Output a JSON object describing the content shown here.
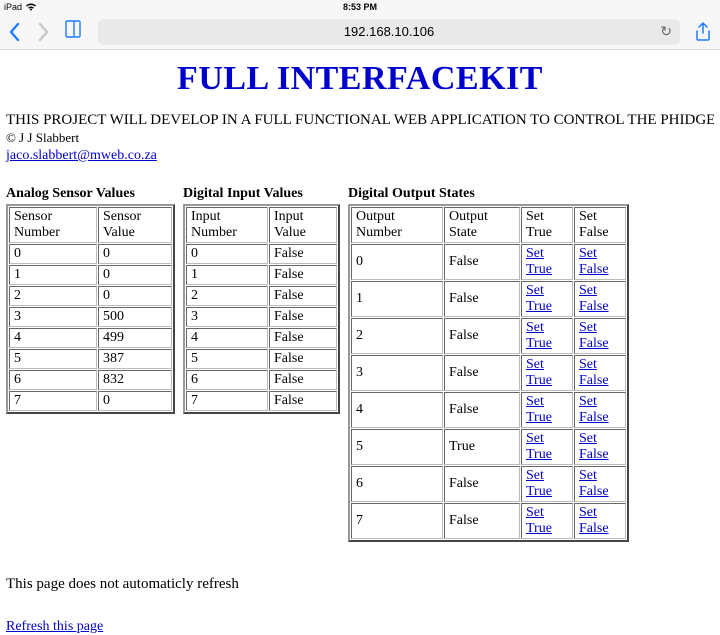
{
  "statusbar": {
    "device": "iPad",
    "time": "8:53 PM"
  },
  "toolbar": {
    "url": "192.168.10.106"
  },
  "page": {
    "title": "FULL INTERFACEKIT",
    "description": "THIS PROJECT WILL DEVELOP IN A FULL FUNCTIONAL WEB APPLICATION TO CONTROL THE PHIDGETS",
    "copyright": "© J J Slabbert",
    "email": "jaco.slabbert@mweb.co.za",
    "refresh_note": "This page does not automaticly refresh",
    "refresh_link": "Refresh this page"
  },
  "analog": {
    "heading": "Analog Sensor Values",
    "col1": "Sensor Number",
    "col2": "Sensor Value",
    "rows": [
      {
        "n": "0",
        "v": "0"
      },
      {
        "n": "1",
        "v": "0"
      },
      {
        "n": "2",
        "v": "0"
      },
      {
        "n": "3",
        "v": "500"
      },
      {
        "n": "4",
        "v": "499"
      },
      {
        "n": "5",
        "v": "387"
      },
      {
        "n": "6",
        "v": "832"
      },
      {
        "n": "7",
        "v": "0"
      }
    ]
  },
  "digital_in": {
    "heading": "Digital Input Values",
    "col1": "Input Number",
    "col2": "Input Value",
    "rows": [
      {
        "n": "0",
        "v": "False"
      },
      {
        "n": "1",
        "v": "False"
      },
      {
        "n": "2",
        "v": "False"
      },
      {
        "n": "3",
        "v": "False"
      },
      {
        "n": "4",
        "v": "False"
      },
      {
        "n": "5",
        "v": "False"
      },
      {
        "n": "6",
        "v": "False"
      },
      {
        "n": "7",
        "v": "False"
      }
    ]
  },
  "digital_out": {
    "heading": "Digital Output States",
    "col1": "Output Number",
    "col2": "Output State",
    "col3": "Set True",
    "col4": "Set False",
    "set_true_label": "Set True",
    "set_false_label": "Set False",
    "rows": [
      {
        "n": "0",
        "v": "False"
      },
      {
        "n": "1",
        "v": "False"
      },
      {
        "n": "2",
        "v": "False"
      },
      {
        "n": "3",
        "v": "False"
      },
      {
        "n": "4",
        "v": "False"
      },
      {
        "n": "5",
        "v": "True"
      },
      {
        "n": "6",
        "v": "False"
      },
      {
        "n": "7",
        "v": "False"
      }
    ]
  }
}
